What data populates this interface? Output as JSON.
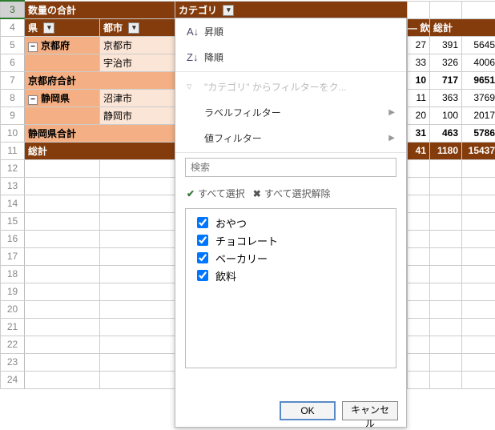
{
  "pivot": {
    "value_label": "数量の合計",
    "category_label": "カテゴリ",
    "pref_label": "県",
    "city_label": "都市",
    "col_right_1": "飲料",
    "col_right_2": "総計",
    "rows": [
      {
        "n": 5,
        "pref": "京都府",
        "city": "京都市",
        "v1": "27",
        "v2": "391",
        "v3": "5645"
      },
      {
        "n": 6,
        "pref": "",
        "city": "宇治市",
        "v1": "33",
        "v2": "326",
        "v3": "4006"
      },
      {
        "n": 7,
        "subtotal": "京都府合計",
        "v1": "10",
        "v2": "717",
        "v3": "9651"
      },
      {
        "n": 8,
        "pref": "静岡県",
        "city": "沼津市",
        "v1": "11",
        "v2": "363",
        "v3": "3769"
      },
      {
        "n": 9,
        "pref": "",
        "city": "静岡市",
        "v1": "20",
        "v2": "100",
        "v3": "2017"
      },
      {
        "n": 10,
        "subtotal": "静岡県合計",
        "v1": "31",
        "v2": "463",
        "v3": "5786"
      }
    ],
    "grand_total_label": "総計",
    "grand_v1": "41",
    "grand_v2": "1180",
    "grand_v3": "15437"
  },
  "menu": {
    "asc": "昇順",
    "desc": "降順",
    "clear_filter": "\"カテゴリ\" からフィルターをク...",
    "label_filter": "ラベルフィルター",
    "value_filter": "値フィルター",
    "search_placeholder": "検索",
    "select_all": "すべて選択",
    "deselect_all": "すべて選択解除",
    "items": [
      "おやつ",
      "チョコレート",
      "ベーカリー",
      "飲料"
    ],
    "ok": "OK",
    "cancel": "キャンセル"
  }
}
